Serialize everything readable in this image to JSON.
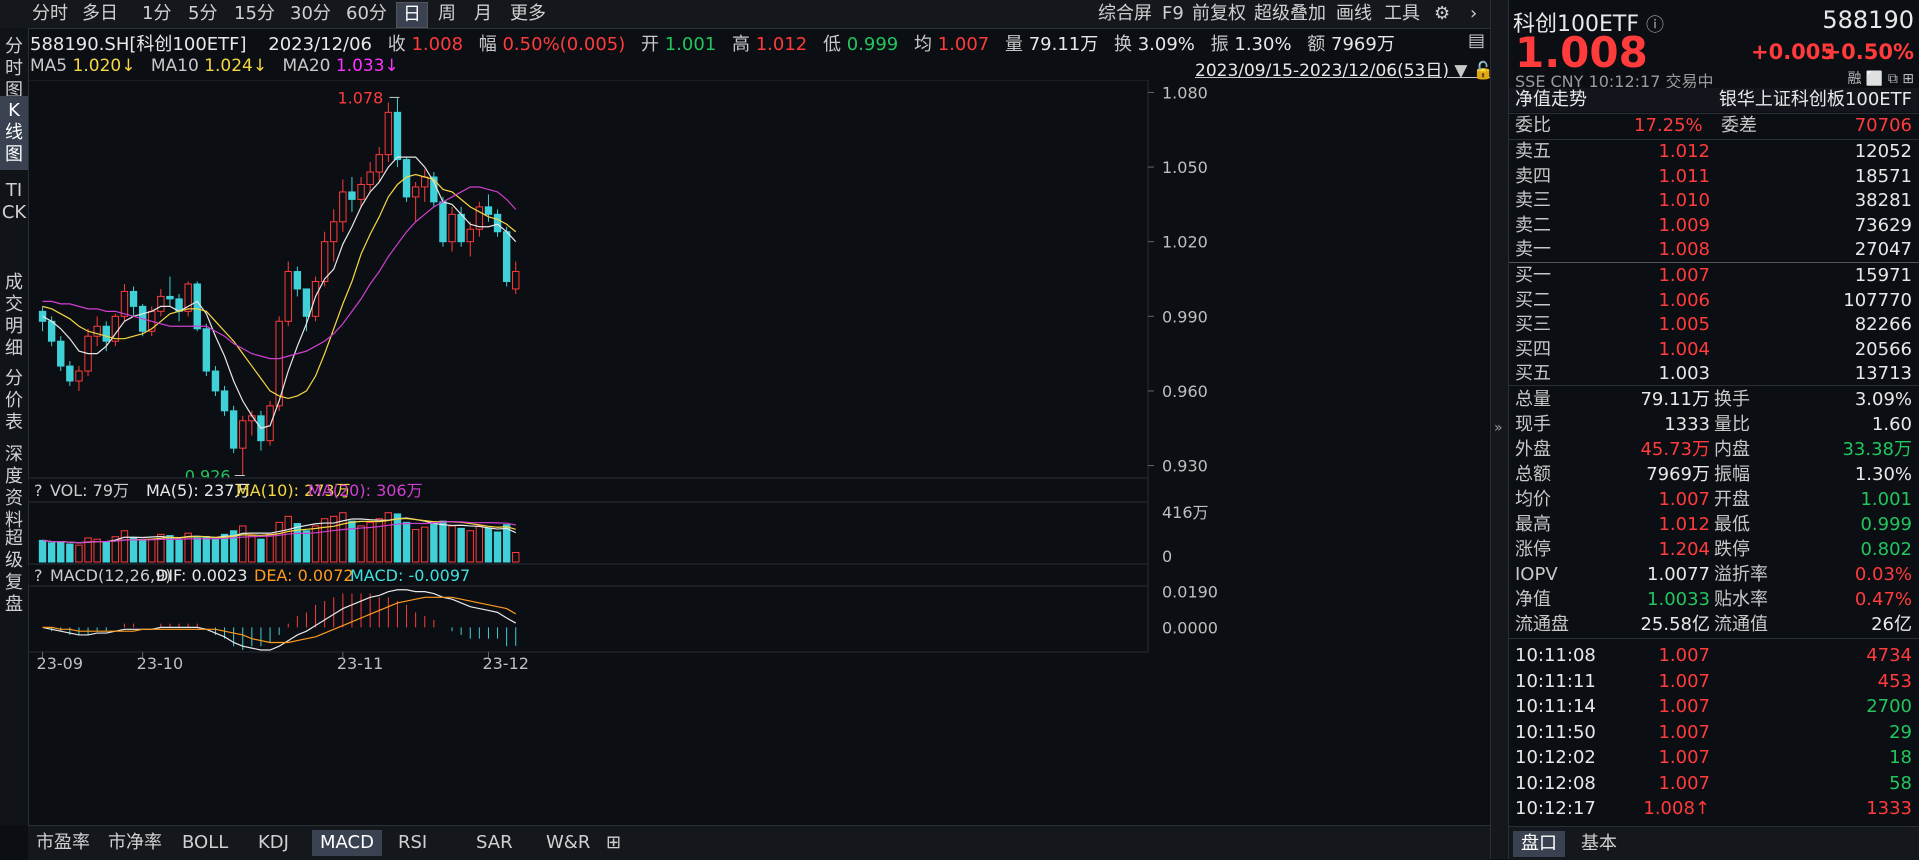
{
  "period_tabs": [
    "分时",
    "多日",
    "1分",
    "5分",
    "15分",
    "30分",
    "60分",
    "日",
    "周",
    "月",
    "更多"
  ],
  "active_period": "日",
  "toolbar": {
    "zhps": "综合屏",
    "f9": "F9",
    "fq": "前复权",
    "cjdj": "超级叠加",
    "hx": "画线",
    "gj": "工具"
  },
  "left_tabs": [
    "分时图",
    "K线图",
    "TICK",
    "成交明细",
    "分价表",
    "深度资料",
    "超级复盘"
  ],
  "info": {
    "code": "588190.SH[科创100ETF]",
    "date": "2023/12/06",
    "close_l": "收",
    "close": "1.008",
    "chg_l": "幅",
    "chg": "0.50%(0.005)",
    "open_l": "开",
    "open": "1.001",
    "high_l": "高",
    "high": "1.012",
    "low_l": "低",
    "low": "0.999",
    "avg_l": "均",
    "avg": "1.007",
    "vol_l": "量",
    "vol": "79.11万",
    "turn_l": "换",
    "turn": "3.09%",
    "amp_l": "振",
    "amp": "1.30%",
    "amt_l": "额",
    "amt": "7969万"
  },
  "ma": {
    "ma5_l": "MA5",
    "ma5": "1.020↓",
    "ma10_l": "MA10",
    "ma10": "1.024↓",
    "ma20_l": "MA20",
    "ma20": "1.033↓"
  },
  "range": "2023/09/15-2023/12/06(53日)",
  "price_axis": [
    "1.080",
    "1.050",
    "1.020",
    "0.990",
    "0.960",
    "0.930"
  ],
  "max_label": "1.078",
  "min_label": "0.926",
  "vol_header": {
    "q": "?",
    "vol": "VOL: 79万",
    "ma5": "MA(5): 237万",
    "ma10": "MA(10): 273万",
    "ma20": "MA(20): 306万"
  },
  "vol_axis": [
    "416万",
    "0"
  ],
  "macd_header": {
    "q": "?",
    "title": "MACD(12,26,9)",
    "dif": "DIF: 0.0023",
    "dea": "DEA: 0.0072",
    "macd": "MACD: -0.0097"
  },
  "macd_axis": [
    "0.0190",
    "0.0000"
  ],
  "date_axis": [
    "23-09",
    "23-10",
    "23-11",
    "23-12"
  ],
  "bottom_tabs": [
    "市盈率",
    "市净率",
    "BOLL",
    "KDJ",
    "MACD",
    "RSI",
    "SAR",
    "W&R"
  ],
  "active_bottom": "MACD",
  "colors": {
    "up": "#ff3b3b",
    "down": "#40d0d8",
    "ma5": "#e8e8e8",
    "ma10": "#f5d742",
    "ma20": "#d040d0",
    "dea": "#ff9a1f"
  },
  "chart_data": {
    "type": "candlestick",
    "date_range": "2023/09/15-2023/12/06",
    "ylim": [
      0.925,
      1.085
    ],
    "candles": [
      [
        0.992,
        0.994,
        0.984,
        0.988
      ],
      [
        0.988,
        0.99,
        0.978,
        0.98
      ],
      [
        0.98,
        0.982,
        0.968,
        0.97
      ],
      [
        0.97,
        0.972,
        0.962,
        0.964
      ],
      [
        0.964,
        0.97,
        0.96,
        0.968
      ],
      [
        0.968,
        0.985,
        0.966,
        0.982
      ],
      [
        0.982,
        0.99,
        0.978,
        0.986
      ],
      [
        0.986,
        0.988,
        0.976,
        0.98
      ],
      [
        0.98,
        0.991,
        0.978,
        0.99
      ],
      [
        0.99,
        1.003,
        0.988,
        1.0
      ],
      [
        1.0,
        1.002,
        0.99,
        0.994
      ],
      [
        0.994,
        0.995,
        0.982,
        0.984
      ],
      [
        0.984,
        0.994,
        0.982,
        0.992
      ],
      [
        0.992,
        1.001,
        0.99,
        0.998
      ],
      [
        0.998,
        1.006,
        0.994,
        0.997
      ],
      [
        0.997,
        0.999,
        0.988,
        0.992
      ],
      [
        0.992,
        1.004,
        0.99,
        1.003
      ],
      [
        1.003,
        1.004,
        0.984,
        0.985
      ],
      [
        0.985,
        0.987,
        0.966,
        0.968
      ],
      [
        0.968,
        0.97,
        0.958,
        0.96
      ],
      [
        0.96,
        0.962,
        0.95,
        0.952
      ],
      [
        0.952,
        0.954,
        0.935,
        0.937
      ],
      [
        0.937,
        0.95,
        0.926,
        0.948
      ],
      [
        0.948,
        0.952,
        0.942,
        0.95
      ],
      [
        0.95,
        0.952,
        0.936,
        0.94
      ],
      [
        0.94,
        0.956,
        0.938,
        0.954
      ],
      [
        0.954,
        0.99,
        0.952,
        0.988
      ],
      [
        0.988,
        1.012,
        0.986,
        1.008
      ],
      [
        1.008,
        1.01,
        0.998,
        1.001
      ],
      [
        1.001,
        0.999,
        0.984,
        0.99
      ],
      [
        0.99,
        1.006,
        0.988,
        1.004
      ],
      [
        1.004,
        1.024,
        1.002,
        1.02
      ],
      [
        1.02,
        1.033,
        1.012,
        1.028
      ],
      [
        1.028,
        1.045,
        1.024,
        1.04
      ],
      [
        1.04,
        1.046,
        1.032,
        1.037
      ],
      [
        1.037,
        1.046,
        1.034,
        1.043
      ],
      [
        1.043,
        1.052,
        1.04,
        1.048
      ],
      [
        1.048,
        1.058,
        1.044,
        1.055
      ],
      [
        1.055,
        1.076,
        1.052,
        1.072
      ],
      [
        1.072,
        1.078,
        1.05,
        1.053
      ],
      [
        1.053,
        1.054,
        1.036,
        1.038
      ],
      [
        1.038,
        1.044,
        1.028,
        1.042
      ],
      [
        1.042,
        1.049,
        1.036,
        1.046
      ],
      [
        1.046,
        1.048,
        1.034,
        1.036
      ],
      [
        1.036,
        1.038,
        1.018,
        1.02
      ],
      [
        1.02,
        1.034,
        1.016,
        1.031
      ],
      [
        1.031,
        1.034,
        1.018,
        1.02
      ],
      [
        1.02,
        1.028,
        1.014,
        1.025
      ],
      [
        1.025,
        1.036,
        1.022,
        1.034
      ],
      [
        1.034,
        1.039,
        1.028,
        1.031
      ],
      [
        1.031,
        1.033,
        1.022,
        1.024
      ],
      [
        1.024,
        1.026,
        1.002,
        1.004
      ],
      [
        1.001,
        1.012,
        0.999,
        1.008
      ]
    ],
    "ma5": [
      0.99,
      0.988,
      0.985,
      0.981,
      0.976,
      0.975,
      0.975,
      0.978,
      0.983,
      0.988,
      0.99,
      0.991,
      0.992,
      0.994,
      0.994,
      0.992,
      0.994,
      0.996,
      0.991,
      0.982,
      0.974,
      0.964,
      0.956,
      0.95,
      0.945,
      0.946,
      0.956,
      0.968,
      0.978,
      0.987,
      0.998,
      1.005,
      1.009,
      1.019,
      1.026,
      1.034,
      1.04,
      1.044,
      1.05,
      1.054,
      1.054,
      1.054,
      1.05,
      1.044,
      1.036,
      1.035,
      1.031,
      1.027,
      1.026,
      1.026,
      1.027,
      1.024,
      1.02
    ],
    "ma10": [
      0.994,
      0.993,
      0.991,
      0.989,
      0.986,
      0.984,
      0.983,
      0.982,
      0.981,
      0.981,
      0.982,
      0.983,
      0.985,
      0.988,
      0.991,
      0.992,
      0.993,
      0.993,
      0.992,
      0.988,
      0.984,
      0.98,
      0.975,
      0.97,
      0.965,
      0.96,
      0.958,
      0.957,
      0.958,
      0.96,
      0.966,
      0.975,
      0.985,
      0.995,
      1.004,
      1.015,
      1.023,
      1.03,
      1.038,
      1.043,
      1.046,
      1.047,
      1.046,
      1.045,
      1.041,
      1.04,
      1.037,
      1.034,
      1.032,
      1.03,
      1.029,
      1.027,
      1.024
    ],
    "ma20": [
      0.996,
      0.996,
      0.995,
      0.995,
      0.994,
      0.993,
      0.993,
      0.992,
      0.992,
      0.991,
      0.99,
      0.989,
      0.988,
      0.987,
      0.986,
      0.986,
      0.986,
      0.986,
      0.986,
      0.984,
      0.982,
      0.979,
      0.977,
      0.975,
      0.974,
      0.973,
      0.973,
      0.974,
      0.975,
      0.976,
      0.978,
      0.98,
      0.983,
      0.987,
      0.992,
      0.997,
      1.003,
      1.008,
      1.014,
      1.019,
      1.024,
      1.028,
      1.031,
      1.034,
      1.036,
      1.038,
      1.04,
      1.042,
      1.042,
      1.041,
      1.04,
      1.037,
      1.033
    ],
    "volume": [
      180,
      160,
      170,
      150,
      140,
      200,
      190,
      170,
      210,
      260,
      200,
      180,
      190,
      230,
      220,
      180,
      240,
      200,
      210,
      190,
      230,
      260,
      300,
      220,
      190,
      230,
      330,
      380,
      320,
      260,
      300,
      360,
      380,
      410,
      340,
      300,
      330,
      360,
      410,
      400,
      330,
      270,
      290,
      320,
      340,
      300,
      280,
      260,
      300,
      280,
      250,
      310,
      79
    ],
    "vol_ylim": [
      0,
      416
    ],
    "macd_dif": [
      0.0,
      -0.001,
      -0.002,
      -0.003,
      -0.004,
      -0.004,
      -0.003,
      -0.003,
      -0.002,
      -0.001,
      -0.001,
      -0.001,
      -0.001,
      0.0,
      0.0,
      0.0,
      0.0,
      0.0,
      -0.001,
      -0.003,
      -0.005,
      -0.008,
      -0.01,
      -0.011,
      -0.012,
      -0.012,
      -0.01,
      -0.007,
      -0.004,
      -0.002,
      0.001,
      0.004,
      0.007,
      0.01,
      0.012,
      0.014,
      0.016,
      0.017,
      0.019,
      0.02,
      0.02,
      0.019,
      0.019,
      0.018,
      0.016,
      0.015,
      0.013,
      0.011,
      0.01,
      0.009,
      0.008,
      0.005,
      0.0023
    ],
    "macd_dea": [
      0.0,
      0.0,
      -0.001,
      -0.001,
      -0.002,
      -0.002,
      -0.002,
      -0.002,
      -0.002,
      -0.002,
      -0.002,
      -0.001,
      -0.001,
      -0.001,
      -0.001,
      -0.001,
      -0.001,
      -0.001,
      -0.001,
      -0.001,
      -0.002,
      -0.003,
      -0.004,
      -0.006,
      -0.007,
      -0.008,
      -0.008,
      -0.008,
      -0.007,
      -0.006,
      -0.005,
      -0.003,
      -0.001,
      0.001,
      0.003,
      0.005,
      0.007,
      0.009,
      0.011,
      0.013,
      0.014,
      0.015,
      0.016,
      0.016,
      0.016,
      0.016,
      0.015,
      0.014,
      0.013,
      0.012,
      0.011,
      0.01,
      0.0072
    ],
    "macd_ylim": [
      -0.012,
      0.022
    ]
  },
  "right": {
    "name": "科创100ETF",
    "code": "588190",
    "price": "1.008",
    "chg": "+0.005",
    "pct": "+0.50%",
    "sub": "SSE  CNY  10:12:17  交易中",
    "jzzs": "净值走势",
    "fullname": "银华上证科创板100ETF",
    "rong": "融",
    "wb_l": "委比",
    "wb": "17.25%",
    "wc_l": "委差",
    "wc": "70706",
    "sells": [
      {
        "l": "卖五",
        "p": "1.012",
        "v": "12052"
      },
      {
        "l": "卖四",
        "p": "1.011",
        "v": "18571"
      },
      {
        "l": "卖三",
        "p": "1.010",
        "v": "38281"
      },
      {
        "l": "卖二",
        "p": "1.009",
        "v": "73629"
      },
      {
        "l": "卖一",
        "p": "1.008",
        "v": "27047"
      }
    ],
    "buys": [
      {
        "l": "买一",
        "p": "1.007",
        "v": "15971"
      },
      {
        "l": "买二",
        "p": "1.006",
        "v": "107770"
      },
      {
        "l": "买三",
        "p": "1.005",
        "v": "82266"
      },
      {
        "l": "买四",
        "p": "1.004",
        "v": "20566"
      },
      {
        "l": "买五",
        "p": "1.003",
        "v": "13713"
      }
    ],
    "stats": [
      {
        "l1": "总量",
        "v1": "79.11万",
        "c1": "white",
        "l2": "换手",
        "v2": "3.09%",
        "c2": "white"
      },
      {
        "l1": "现手",
        "v1": "1333",
        "c1": "white",
        "l2": "量比",
        "v2": "1.60",
        "c2": "white"
      },
      {
        "l1": "外盘",
        "v1": "45.73万",
        "c1": "red",
        "l2": "内盘",
        "v2": "33.38万",
        "c2": "green"
      },
      {
        "l1": "总额",
        "v1": "7969万",
        "c1": "white",
        "l2": "振幅",
        "v2": "1.30%",
        "c2": "white"
      },
      {
        "l1": "均价",
        "v1": "1.007",
        "c1": "red",
        "l2": "开盘",
        "v2": "1.001",
        "c2": "green"
      },
      {
        "l1": "最高",
        "v1": "1.012",
        "c1": "red",
        "l2": "最低",
        "v2": "0.999",
        "c2": "green"
      },
      {
        "l1": "涨停",
        "v1": "1.204",
        "c1": "red",
        "l2": "跌停",
        "v2": "0.802",
        "c2": "green"
      },
      {
        "l1": "IOPV",
        "v1": "1.0077",
        "c1": "white",
        "l2": "溢折率",
        "v2": "0.03%",
        "c2": "red"
      },
      {
        "l1": "净值",
        "v1": "1.0033",
        "c1": "green",
        "l2": "贴水率",
        "v2": "0.47%",
        "c2": "red"
      },
      {
        "l1": "流通盘",
        "v1": "25.58亿",
        "c1": "white",
        "l2": "流通值",
        "v2": "26亿",
        "c2": "white"
      }
    ],
    "ticks": [
      {
        "t": "10:11:08",
        "p": "1.007",
        "v": "4734",
        "vc": "red"
      },
      {
        "t": "10:11:11",
        "p": "1.007",
        "v": "453",
        "vc": "red"
      },
      {
        "t": "10:11:14",
        "p": "1.007",
        "v": "2700",
        "vc": "green"
      },
      {
        "t": "10:11:50",
        "p": "1.007",
        "v": "29",
        "vc": "green"
      },
      {
        "t": "10:12:02",
        "p": "1.007",
        "v": "18",
        "vc": "green"
      },
      {
        "t": "10:12:08",
        "p": "1.007",
        "v": "58",
        "vc": "green"
      },
      {
        "t": "10:12:17",
        "p": "1.008↑",
        "v": "1333",
        "vc": "red"
      }
    ],
    "tabs": [
      "盘口",
      "基本"
    ]
  }
}
